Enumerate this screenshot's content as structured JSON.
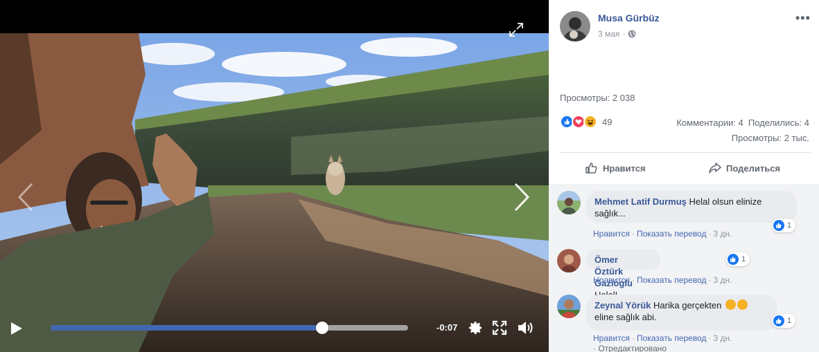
{
  "video": {
    "time_remaining": "-0:07",
    "progress_fraction": 0.76,
    "icons": [
      "expand-icon",
      "prev-arrow-icon",
      "next-arrow-icon",
      "play-icon",
      "gear-icon",
      "fullscreen-icon",
      "volume-icon"
    ]
  },
  "post": {
    "author": "Musa Gürbüz",
    "date": "3 мая",
    "views_top": "Просмотры: 2 038",
    "reaction_count": "49",
    "stats": "Комментарии: 4  Поделились: 4",
    "views_bottom": "Просмотры: 2 тыс.",
    "like_label": "Нравится",
    "share_label": "Поделиться",
    "colors": {
      "link": "#385898",
      "like_blue": "#1877f2",
      "love_red": "#f33e58",
      "haha_yellow": "#f7b125"
    }
  },
  "comments": [
    {
      "name": "Mehmet Latif Durmuş",
      "text_line1": "Helal olsun elinize",
      "text_line2": "sağlık...",
      "likes": "1",
      "like": "Нравится",
      "translate": "Показать перевод",
      "age": "3 дн."
    },
    {
      "name": "Ömer Öztürk Gazioglu",
      "text_line1": "Helal!",
      "likes": "1",
      "like": "Нравится",
      "translate": "Показать перевод",
      "age": "3 дн."
    },
    {
      "name": "Zeynal Yörük",
      "text_line1": "Harika gerçekten",
      "text_line2": "eline sağlık abi.",
      "likes": "1",
      "like": "Нравится",
      "translate": "Показать перевод",
      "age": "3 дн.",
      "edited": "Отредактировано"
    }
  ]
}
